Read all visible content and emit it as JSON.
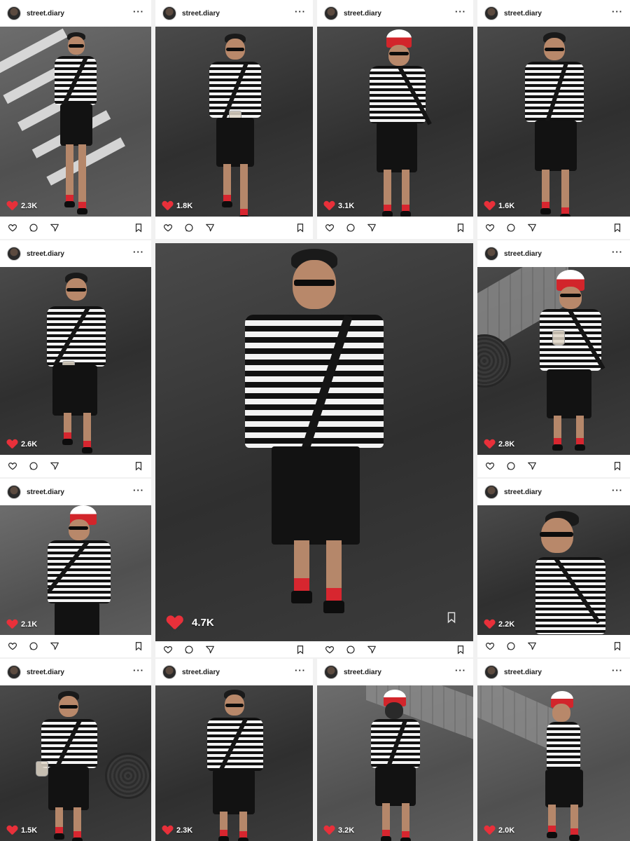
{
  "username": "street.diary",
  "more_label": "···",
  "colors": {
    "heart": "#e8303a",
    "sock": "#d7262f",
    "cap_red": "#d2252b"
  },
  "icons": [
    "heart-outline-icon",
    "comment-icon",
    "share-icon",
    "bookmark-icon",
    "more-icon"
  ],
  "posts": [
    {
      "likes": "2.3K"
    },
    {
      "likes": "1.8K"
    },
    {
      "likes": "3.1K"
    },
    {
      "likes": "1.6K"
    },
    {
      "likes": "2.6K"
    },
    {
      "likes": "2.8K"
    },
    {
      "likes": "2.1K"
    },
    {
      "likes": "2.2K"
    },
    {
      "likes": "1.5K"
    },
    {
      "likes": "2.3K"
    },
    {
      "likes": "3.2K"
    },
    {
      "likes": "2.0K"
    }
  ],
  "featured": {
    "likes": "4.7K"
  }
}
